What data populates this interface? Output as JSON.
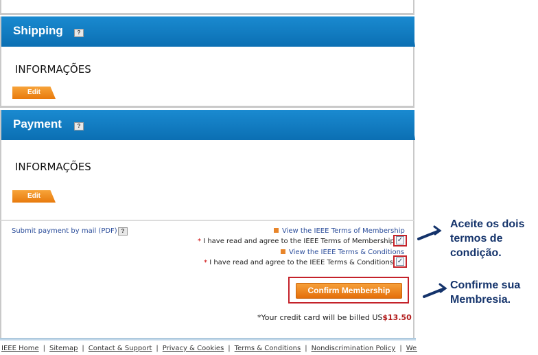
{
  "shipping": {
    "title": "Shipping",
    "help": "?",
    "info": "INFORMAÇÕES",
    "edit_label": "Edit"
  },
  "payment": {
    "title": "Payment",
    "help": "?",
    "info": "INFORMAÇÕES",
    "edit_label": "Edit"
  },
  "terms": {
    "submit_by_mail": "Submit payment by mail (PDF)",
    "help": "?",
    "view_membership_terms": "View the IEEE Terms of Membership",
    "agree_membership": "I have read and agree to the IEEE Terms of Membership",
    "view_terms_conditions": "View the IEEE Terms & Conditions",
    "agree_conditions": "I have read and agree to the IEEE Terms & Conditions",
    "required_mark": "*",
    "checkmark": "✓"
  },
  "confirm": {
    "button_label": "Confirm Membership",
    "billed_text": "*Your credit card will be billed US",
    "amount": "$13.50"
  },
  "footer": {
    "links": [
      "IEEE Home",
      "Sitemap",
      "Contact & Support",
      "Privacy & Cookies",
      "Terms & Conditions",
      "Nondiscrimination Policy",
      "Web Site Feedback"
    ],
    "separator": "|"
  },
  "annotations": {
    "accept_line1": "Aceite os dois",
    "accept_line2": "termos de",
    "accept_line3": "condição.",
    "confirm_line1": "Confirme sua",
    "confirm_line2": "Membresia."
  },
  "colors": {
    "header_blue": "#0b6fb3",
    "accent_orange": "#e87a0c",
    "highlight_red": "#c4222a",
    "annotation_navy": "#14336b"
  }
}
